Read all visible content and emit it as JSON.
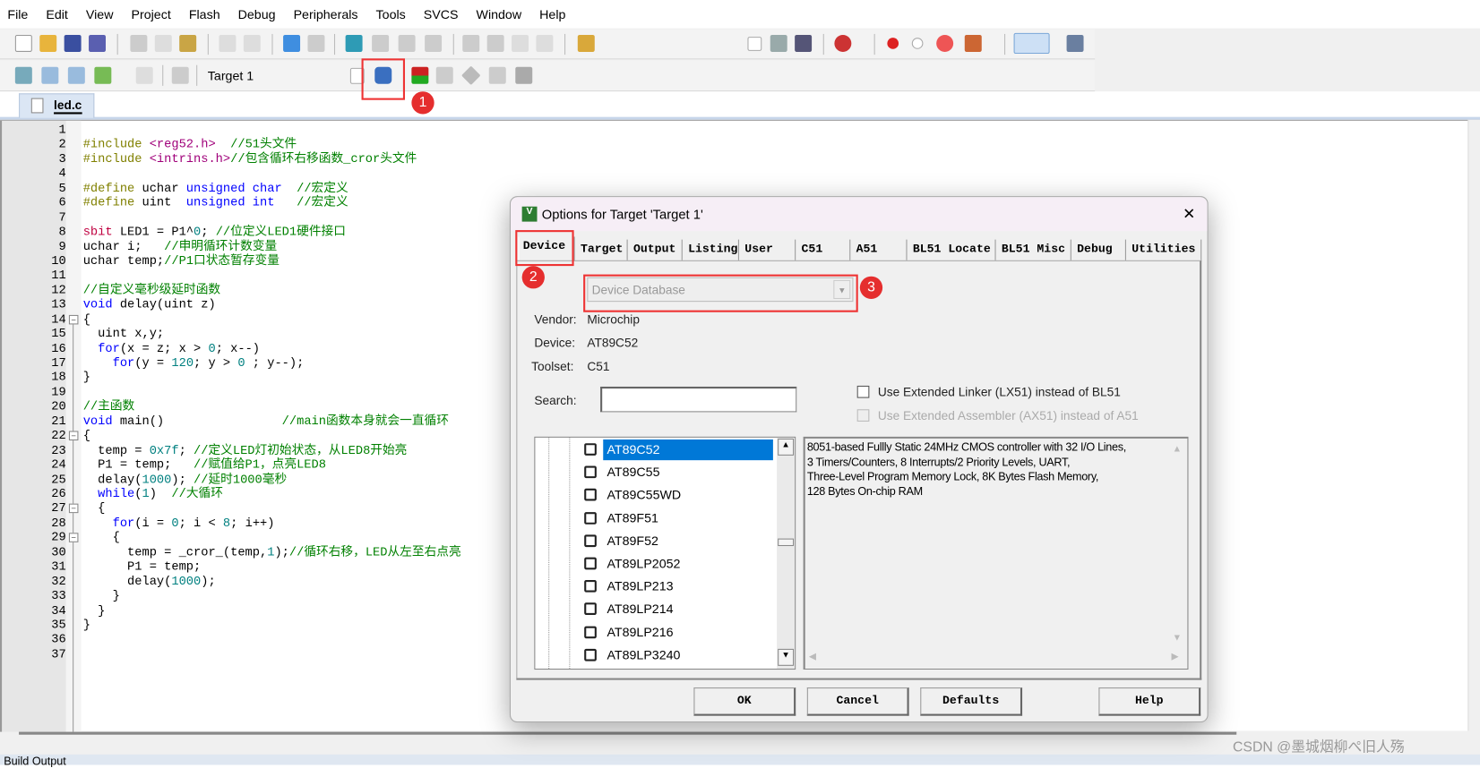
{
  "menu": [
    "File",
    "Edit",
    "View",
    "Project",
    "Flash",
    "Debug",
    "Peripherals",
    "Tools",
    "SVCS",
    "Window",
    "Help"
  ],
  "toolbar": {
    "target_select": "Target 1",
    "highlighted_button": "options-for-target"
  },
  "file_tab": "led.c",
  "editor": {
    "lines": [
      [],
      [
        [
          "pp",
          "#include "
        ],
        [
          "str",
          "<reg52.h>"
        ],
        [
          "tx",
          "  "
        ],
        [
          "cm",
          "//51头文件"
        ]
      ],
      [
        [
          "pp",
          "#include "
        ],
        [
          "str",
          "<intrins.h>"
        ],
        [
          "cm",
          "//包含循环右移函数_cror头文件"
        ]
      ],
      [],
      [
        [
          "pp",
          "#define "
        ],
        [
          "tx",
          "uchar "
        ],
        [
          "kw",
          "unsigned char"
        ],
        [
          "tx",
          "  "
        ],
        [
          "cm",
          "//宏定义"
        ]
      ],
      [
        [
          "pp",
          "#define "
        ],
        [
          "tx",
          "uint  "
        ],
        [
          "kw",
          "unsigned int"
        ],
        [
          "tx",
          "   "
        ],
        [
          "cm",
          "//宏定义"
        ]
      ],
      [],
      [
        [
          "sb",
          "sbit"
        ],
        [
          "tx",
          " LED1 = P1^"
        ],
        [
          "num",
          "0"
        ],
        [
          "tx",
          "; "
        ],
        [
          "cm",
          "//位定义LED1硬件接口"
        ]
      ],
      [
        [
          "tx",
          "uchar i;   "
        ],
        [
          "cm",
          "//申明循环计数变量"
        ]
      ],
      [
        [
          "tx",
          "uchar temp;"
        ],
        [
          "cm",
          "//P1口状态暂存变量"
        ]
      ],
      [],
      [
        [
          "cm",
          "//自定义毫秒级延时函数"
        ]
      ],
      [
        [
          "kw",
          "void"
        ],
        [
          "tx",
          " delay(uint z)"
        ]
      ],
      [
        [
          "tx",
          "{"
        ]
      ],
      [
        [
          "tx",
          "  uint x,y;"
        ]
      ],
      [
        [
          "tx",
          "  "
        ],
        [
          "kw",
          "for"
        ],
        [
          "tx",
          "(x = z; x > "
        ],
        [
          "num",
          "0"
        ],
        [
          "tx",
          "; x--)"
        ]
      ],
      [
        [
          "tx",
          "    "
        ],
        [
          "kw",
          "for"
        ],
        [
          "tx",
          "(y = "
        ],
        [
          "num",
          "120"
        ],
        [
          "tx",
          "; y > "
        ],
        [
          "num",
          "0"
        ],
        [
          "tx",
          " ; y--);"
        ]
      ],
      [
        [
          "tx",
          "}"
        ]
      ],
      [],
      [
        [
          "cm",
          "//主函数"
        ]
      ],
      [
        [
          "kw",
          "void"
        ],
        [
          "tx",
          " main()                "
        ],
        [
          "cm",
          "//main函数本身就会一直循环"
        ]
      ],
      [
        [
          "tx",
          "{"
        ]
      ],
      [
        [
          "tx",
          "  temp = "
        ],
        [
          "num",
          "0x7f"
        ],
        [
          "tx",
          "; "
        ],
        [
          "cm",
          "//定义LED灯初始状态，从LED8开始亮"
        ]
      ],
      [
        [
          "tx",
          "  P1 = temp;   "
        ],
        [
          "cm",
          "//赋值给P1，点亮LED8"
        ]
      ],
      [
        [
          "tx",
          "  delay("
        ],
        [
          "num",
          "1000"
        ],
        [
          "tx",
          "); "
        ],
        [
          "cm",
          "//延时1000毫秒"
        ]
      ],
      [
        [
          "tx",
          "  "
        ],
        [
          "kw",
          "while"
        ],
        [
          "tx",
          "("
        ],
        [
          "num",
          "1"
        ],
        [
          "tx",
          ")  "
        ],
        [
          "cm",
          "//大循环"
        ]
      ],
      [
        [
          "tx",
          "  {"
        ]
      ],
      [
        [
          "tx",
          "    "
        ],
        [
          "kw",
          "for"
        ],
        [
          "tx",
          "(i = "
        ],
        [
          "num",
          "0"
        ],
        [
          "tx",
          "; i < "
        ],
        [
          "num",
          "8"
        ],
        [
          "tx",
          "; i++)"
        ]
      ],
      [
        [
          "tx",
          "    {"
        ]
      ],
      [
        [
          "tx",
          "      temp = _cror_(temp,"
        ],
        [
          "num",
          "1"
        ],
        [
          "tx",
          ");"
        ],
        [
          "cm",
          "//循环右移，LED从左至右点亮"
        ]
      ],
      [
        [
          "tx",
          "      P1 = temp;"
        ]
      ],
      [
        [
          "tx",
          "      delay("
        ],
        [
          "num",
          "1000"
        ],
        [
          "tx",
          ");"
        ]
      ],
      [
        [
          "tx",
          "    }"
        ]
      ],
      [
        [
          "tx",
          "  }"
        ]
      ],
      [
        [
          "tx",
          "}"
        ]
      ],
      [],
      []
    ],
    "fold_lines": [
      14,
      22,
      27,
      29
    ]
  },
  "dialog": {
    "title": "Options for Target 'Target 1'",
    "close": "✕",
    "tabs": [
      "Device",
      "Target",
      "Output",
      "Listing",
      "User",
      "C51",
      "A51",
      "BL51 Locate",
      "BL51 Misc",
      "Debug",
      "Utilities"
    ],
    "active_tab": "Device",
    "database_select": "Device Database",
    "vendor_label": "Vendor:",
    "vendor": "Microchip",
    "device_label": "Device:",
    "device": "AT89C52",
    "toolset_label": "Toolset:",
    "toolset": "C51",
    "search_label": "Search:",
    "search_value": "",
    "opt_linker": "Use Extended Linker (LX51) instead of BL51",
    "opt_assembler": "Use Extended Assembler (AX51) instead of A51",
    "devices": [
      "AT89C52",
      "AT89C55",
      "AT89C55WD",
      "AT89F51",
      "AT89F52",
      "AT89LP2052",
      "AT89LP213",
      "AT89LP214",
      "AT89LP216",
      "AT89LP3240"
    ],
    "selected_device": "AT89C52",
    "description": "8051-based Fullly Static 24MHz CMOS controller with 32  I/O Lines,\n3 Timers/Counters, 8 Interrupts/2 Priority Levels, UART,\nThree-Level Program Memory Lock, 8K Bytes Flash Memory,\n128 Bytes On-chip RAM",
    "buttons": {
      "ok": "OK",
      "cancel": "Cancel",
      "defaults": "Defaults",
      "help": "Help"
    }
  },
  "annotations": [
    "1",
    "2",
    "3"
  ],
  "build_output": "Build Output",
  "watermark": "CSDN @墨城烟柳ぺ旧人殇",
  "colors": {
    "selection": "#0078d7",
    "annotation": "#e52e2e",
    "comment": "#008000",
    "keyword": "#0000ff"
  }
}
